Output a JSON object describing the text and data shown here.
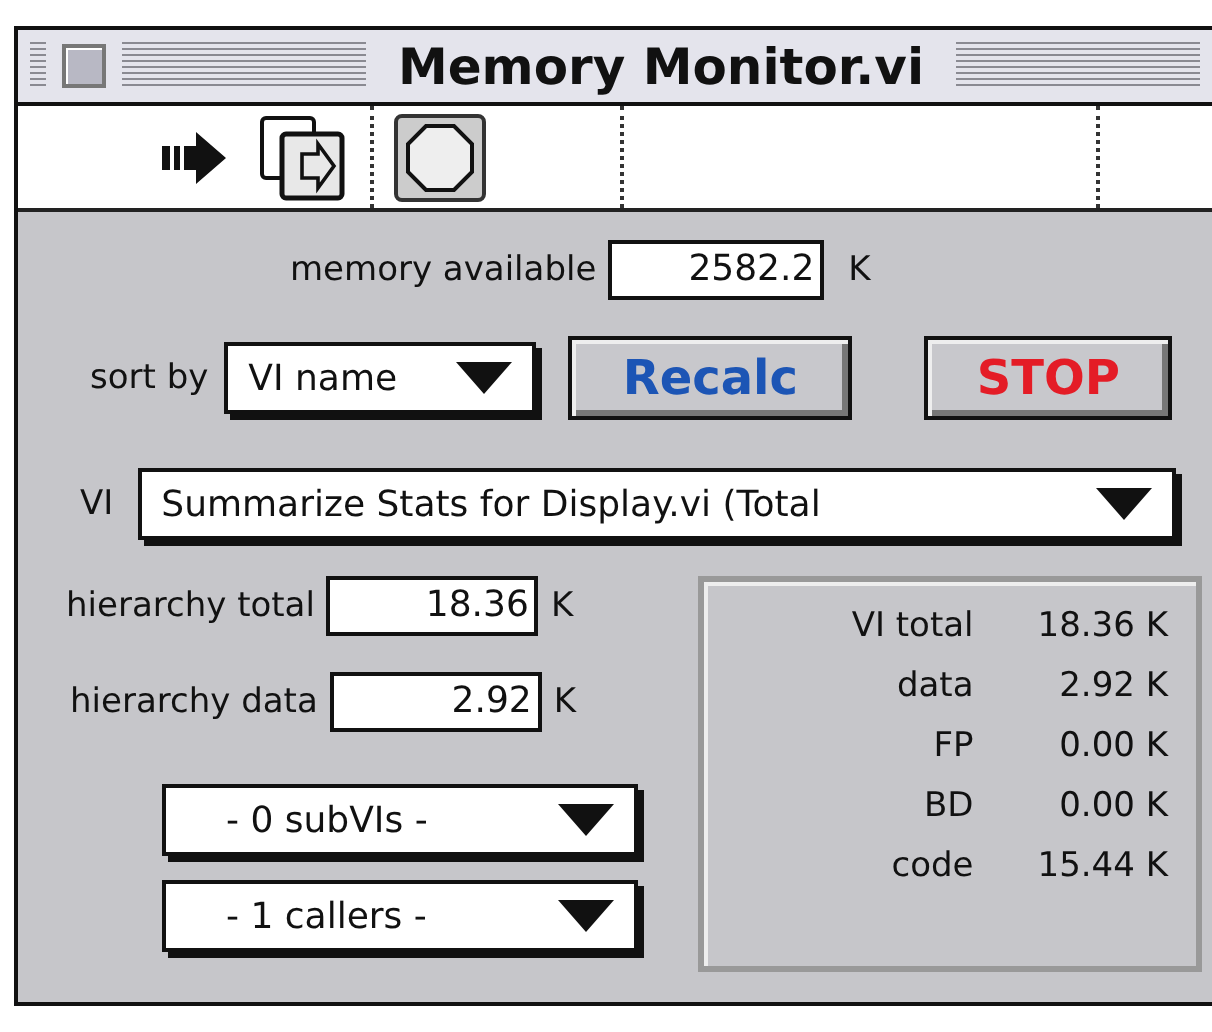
{
  "window": {
    "title": "Memory Monitor.vi"
  },
  "memory": {
    "label": "memory available",
    "value": "2582.2",
    "unit": "K"
  },
  "sort": {
    "label": "sort by",
    "value": "VI name"
  },
  "buttons": [
    {
      "label": "Recalc",
      "kind": "recalc"
    },
    {
      "label": "STOP",
      "kind": "stop"
    }
  ],
  "vi": {
    "label": "VI",
    "value": "Summarize Stats for Display.vi (Total"
  },
  "hierarchy": [
    {
      "label": "hierarchy total",
      "value": "18.36",
      "unit": "K"
    },
    {
      "label": "hierarchy data",
      "value": "2.92",
      "unit": "K"
    }
  ],
  "menus": [
    "- 0 subVIs -",
    "- 1 callers -"
  ],
  "stats": [
    {
      "label": "VI total",
      "value": "18.36 K"
    },
    {
      "label": "data",
      "value": "2.92 K"
    },
    {
      "label": "FP",
      "value": "0.00 K"
    },
    {
      "label": "BD",
      "value": "0.00 K"
    },
    {
      "label": "code",
      "value": "15.44 K"
    }
  ]
}
